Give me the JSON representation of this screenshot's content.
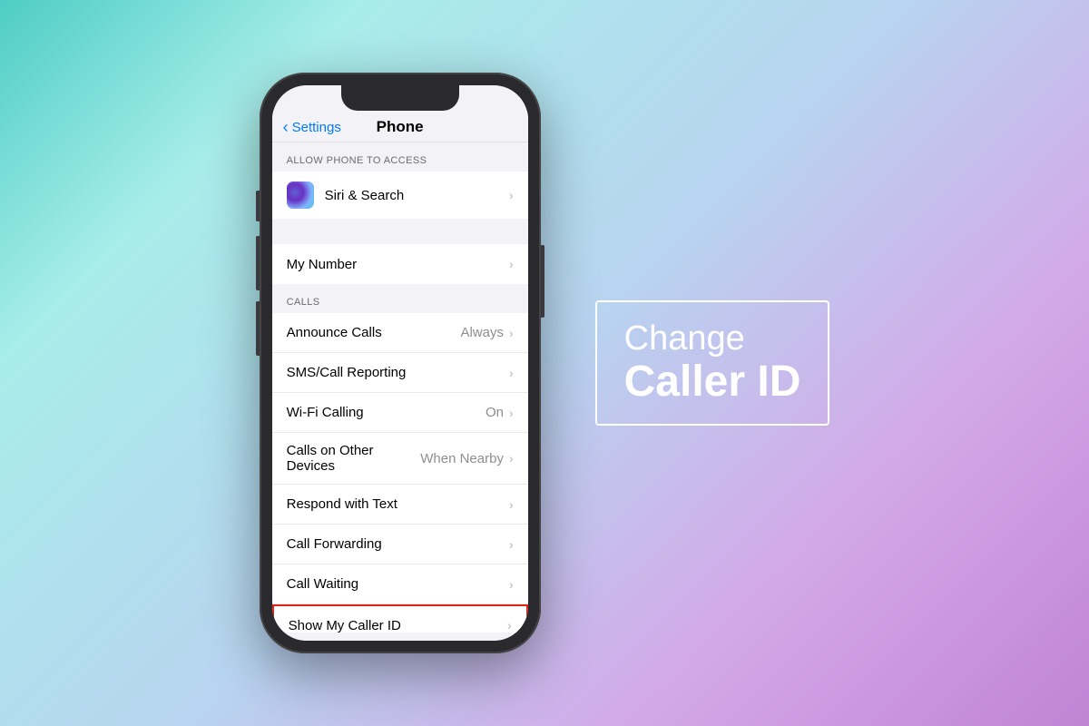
{
  "background": {
    "gradient": "linear-gradient(135deg, #4ecdc4, #b8d4f0, #c084d4)"
  },
  "phone": {
    "header": {
      "back_label": "Settings",
      "title": "Phone"
    },
    "sections": [
      {
        "id": "allow-access",
        "header": "ALLOW PHONE TO ACCESS",
        "items": [
          {
            "id": "siri-search",
            "label": "Siri & Search",
            "value": "",
            "has_icon": true,
            "highlighted": false
          }
        ]
      },
      {
        "id": "my-number-section",
        "header": "",
        "items": [
          {
            "id": "my-number",
            "label": "My Number",
            "value": "",
            "has_icon": false,
            "highlighted": false
          }
        ]
      },
      {
        "id": "calls-section",
        "header": "CALLS",
        "items": [
          {
            "id": "announce-calls",
            "label": "Announce Calls",
            "value": "Always",
            "has_icon": false,
            "highlighted": false
          },
          {
            "id": "sms-call-reporting",
            "label": "SMS/Call Reporting",
            "value": "",
            "has_icon": false,
            "highlighted": false
          },
          {
            "id": "wifi-calling",
            "label": "Wi-Fi Calling",
            "value": "On",
            "has_icon": false,
            "highlighted": false
          },
          {
            "id": "calls-other-devices",
            "label": "Calls on Other Devices",
            "value": "When Nearby",
            "has_icon": false,
            "highlighted": false
          },
          {
            "id": "respond-with-text",
            "label": "Respond with Text",
            "value": "",
            "has_icon": false,
            "highlighted": false
          },
          {
            "id": "call-forwarding",
            "label": "Call Forwarding",
            "value": "",
            "has_icon": false,
            "highlighted": false
          },
          {
            "id": "call-waiting",
            "label": "Call Waiting",
            "value": "",
            "has_icon": false,
            "highlighted": false
          },
          {
            "id": "show-caller-id",
            "label": "Show My Caller ID",
            "value": "",
            "has_icon": false,
            "highlighted": true
          }
        ]
      }
    ]
  },
  "callout": {
    "line1": "Change",
    "line2": "Caller ID"
  },
  "icons": {
    "back_chevron": "‹",
    "chevron_right": "›"
  }
}
